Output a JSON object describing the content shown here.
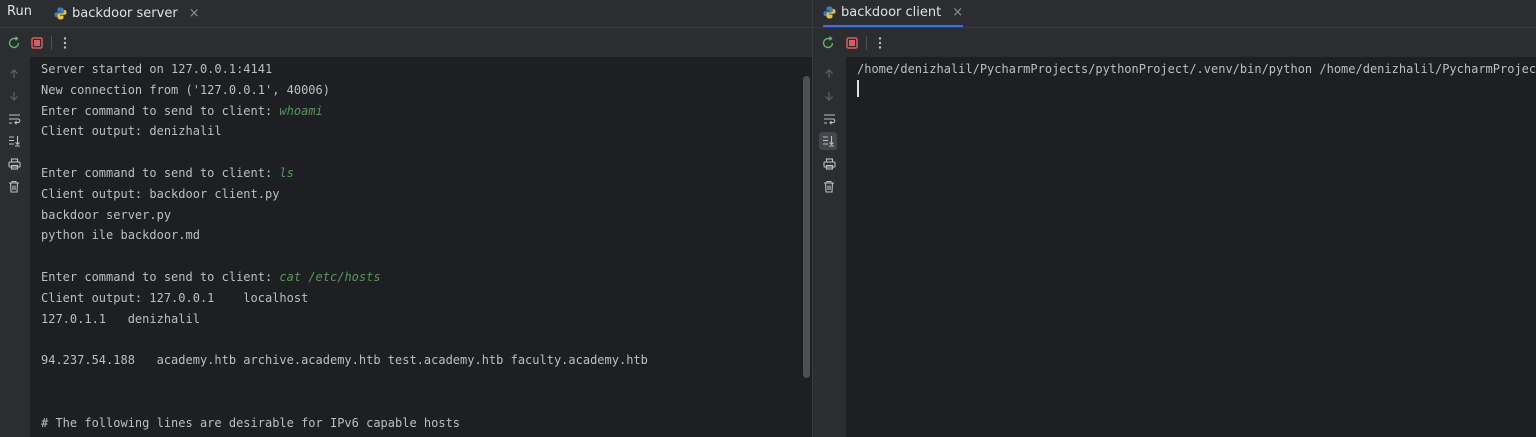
{
  "left": {
    "run_label": "Run",
    "tab_label": "backdoor server",
    "tab_close": "×",
    "lines": [
      {
        "text": "Server started on 127.0.0.1:4141",
        "input": ""
      },
      {
        "text": "New connection from ('127.0.0.1', 40006)",
        "input": ""
      },
      {
        "text": "Enter command to send to client: ",
        "input": "whoami"
      },
      {
        "text": "Client output: denizhalil",
        "input": ""
      },
      {
        "text": "",
        "input": ""
      },
      {
        "text": "Enter command to send to client: ",
        "input": "ls"
      },
      {
        "text": "Client output: backdoor client.py",
        "input": ""
      },
      {
        "text": "backdoor server.py",
        "input": ""
      },
      {
        "text": "python ile backdoor.md",
        "input": ""
      },
      {
        "text": "",
        "input": ""
      },
      {
        "text": "Enter command to send to client: ",
        "input": "cat /etc/hosts"
      },
      {
        "text": "Client output: 127.0.0.1    localhost",
        "input": ""
      },
      {
        "text": "127.0.1.1   denizhalil",
        "input": ""
      },
      {
        "text": "",
        "input": ""
      },
      {
        "text": "94.237.54.188   academy.htb archive.academy.htb test.academy.htb faculty.academy.htb",
        "input": ""
      },
      {
        "text": "",
        "input": ""
      },
      {
        "text": "",
        "input": ""
      },
      {
        "text": "# The following lines are desirable for IPv6 capable hosts",
        "input": ""
      }
    ]
  },
  "right": {
    "tab_label": "backdoor client",
    "tab_close": "×",
    "lines": [
      {
        "text": "/home/denizhalil/PycharmProjects/pythonProject/.venv/bin/python /home/denizhalil/PycharmProjects/p",
        "input": ""
      }
    ]
  },
  "colors": {
    "accent": "#3574f0",
    "stop": "#db5c5c",
    "input_text": "#57965c"
  }
}
